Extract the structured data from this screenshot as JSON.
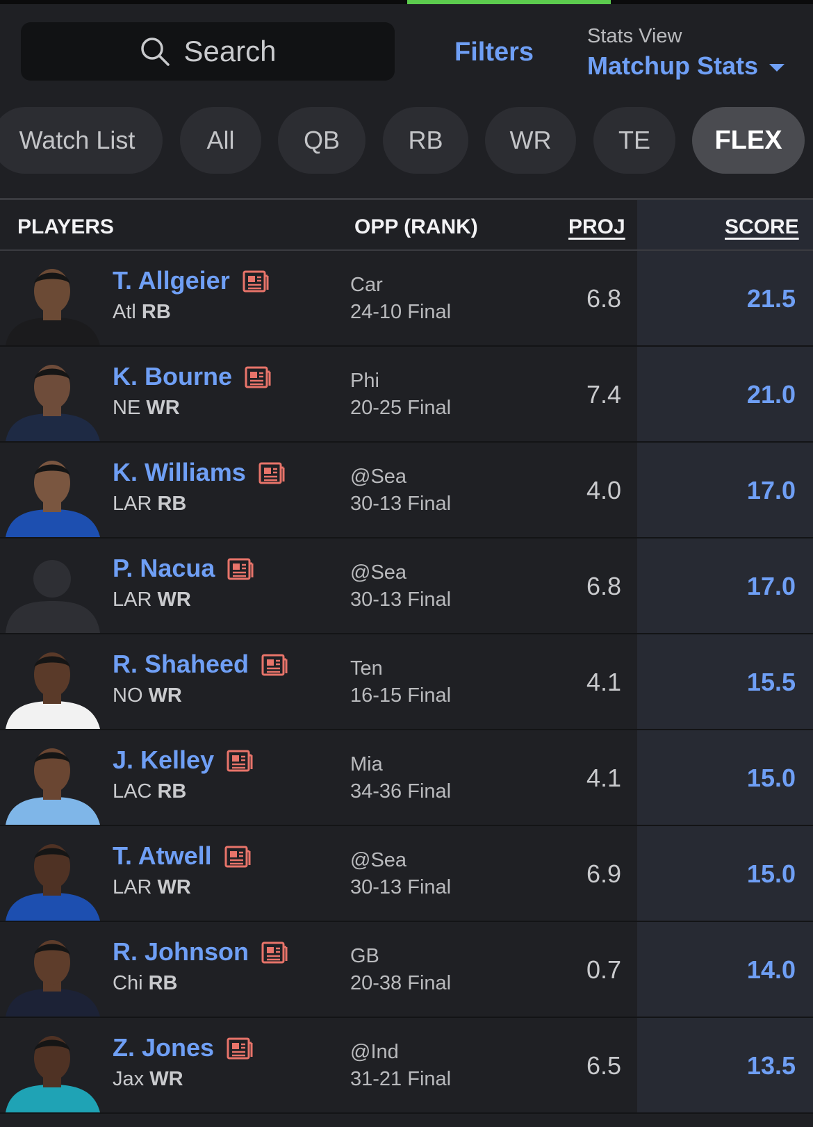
{
  "top": {
    "search_placeholder": "Search",
    "filters_label": "Filters",
    "stats_view_label": "Stats View",
    "stats_view_value": "Matchup Stats"
  },
  "tabs": [
    {
      "label": "Watch List",
      "active": false
    },
    {
      "label": "All",
      "active": false
    },
    {
      "label": "QB",
      "active": false
    },
    {
      "label": "RB",
      "active": false
    },
    {
      "label": "WR",
      "active": false
    },
    {
      "label": "TE",
      "active": false
    },
    {
      "label": "FLEX",
      "active": true
    }
  ],
  "table": {
    "headers": {
      "players": "PLAYERS",
      "opp": "OPP (RANK)",
      "proj": "PROJ",
      "score": "SCORE"
    },
    "rows": [
      {
        "name": "T. Allgeier",
        "team": "Atl",
        "pos": "RB",
        "opp": "Car",
        "result": "24-10 Final",
        "proj": "6.8",
        "score": "21.5",
        "jersey": "#1b1b1d",
        "skin": "#6b4a35"
      },
      {
        "name": "K. Bourne",
        "team": "NE",
        "pos": "WR",
        "opp": "Phi",
        "result": "20-25 Final",
        "proj": "7.4",
        "score": "21.0",
        "jersey": "#1e2a44",
        "skin": "#6e4c3a"
      },
      {
        "name": "K. Williams",
        "team": "LAR",
        "pos": "RB",
        "opp": "@Sea",
        "result": "30-13 Final",
        "proj": "4.0",
        "score": "17.0",
        "jersey": "#1d4fb0",
        "skin": "#7a5640"
      },
      {
        "name": "P. Nacua",
        "team": "LAR",
        "pos": "WR",
        "opp": "@Sea",
        "result": "30-13 Final",
        "proj": "6.8",
        "score": "17.0",
        "jersey": "#2e2f34",
        "skin": "#2e2f34",
        "placeholder": true
      },
      {
        "name": "R. Shaheed",
        "team": "NO",
        "pos": "WR",
        "opp": "Ten",
        "result": "16-15 Final",
        "proj": "4.1",
        "score": "15.5",
        "jersey": "#f2f2f2",
        "skin": "#5a3a29"
      },
      {
        "name": "J. Kelley",
        "team": "LAC",
        "pos": "RB",
        "opp": "Mia",
        "result": "34-36 Final",
        "proj": "4.1",
        "score": "15.0",
        "jersey": "#7fb6e8",
        "skin": "#6a4632"
      },
      {
        "name": "T. Atwell",
        "team": "LAR",
        "pos": "WR",
        "opp": "@Sea",
        "result": "30-13 Final",
        "proj": "6.9",
        "score": "15.0",
        "jersey": "#1d4fb0",
        "skin": "#4f3224"
      },
      {
        "name": "R. Johnson",
        "team": "Chi",
        "pos": "RB",
        "opp": "GB",
        "result": "20-38 Final",
        "proj": "0.7",
        "score": "14.0",
        "jersey": "#1c2236",
        "skin": "#5e3d2b"
      },
      {
        "name": "Z. Jones",
        "team": "Jax",
        "pos": "WR",
        "opp": "@Ind",
        "result": "31-21 Final",
        "proj": "6.5",
        "score": "13.5",
        "jersey": "#1fa3b5",
        "skin": "#4f3224"
      }
    ]
  },
  "colors": {
    "accent": "#6f9ff5",
    "news_icon": "#e8746a",
    "progress": "#5ccb4e"
  }
}
